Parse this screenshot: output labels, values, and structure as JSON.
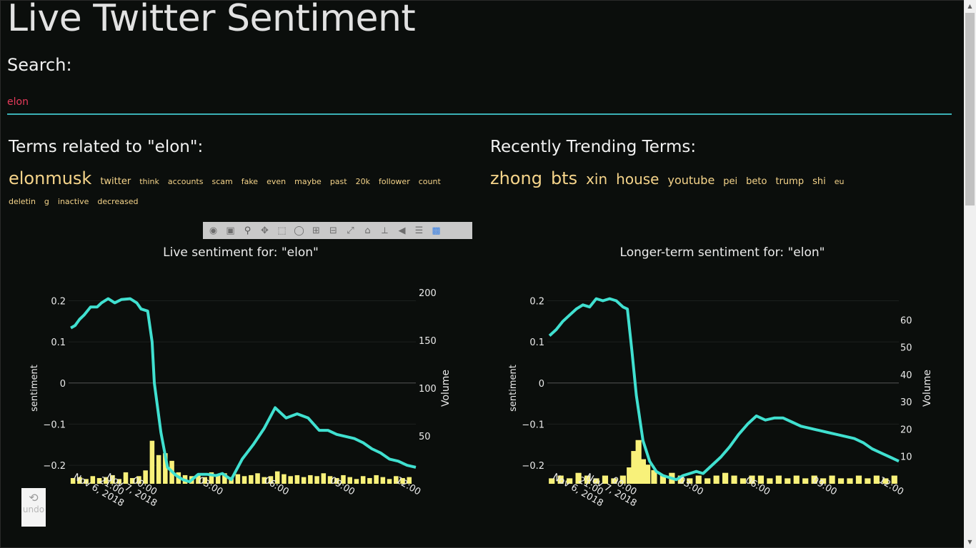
{
  "page": {
    "title": "Live Twitter Sentiment",
    "search_label": "Search:",
    "search_value": "elon",
    "related_heading": "Terms related to \"elon\":",
    "trending_heading": "Recently Trending Terms:",
    "undo_label": "undo"
  },
  "related_terms": [
    {
      "text": "elonmusk",
      "size": "lg"
    },
    {
      "text": "twitter",
      "size": "sm"
    },
    {
      "text": "think",
      "size": "xs"
    },
    {
      "text": "accounts",
      "size": "xs"
    },
    {
      "text": "scam",
      "size": "xs"
    },
    {
      "text": "fake",
      "size": "xs"
    },
    {
      "text": "even",
      "size": "xs"
    },
    {
      "text": "maybe",
      "size": "xs"
    },
    {
      "text": "past",
      "size": "xs"
    },
    {
      "text": "20k",
      "size": "xs"
    },
    {
      "text": "follower",
      "size": "xs"
    },
    {
      "text": "count",
      "size": "xs"
    },
    {
      "text": "deletin",
      "size": "xs"
    },
    {
      "text": "g",
      "size": "xs"
    },
    {
      "text": "inactive",
      "size": "xs"
    },
    {
      "text": "decreased",
      "size": "xs"
    }
  ],
  "trending_terms": [
    {
      "text": "zhong",
      "size": "lg"
    },
    {
      "text": "bts",
      "size": "lg"
    },
    {
      "text": "xin",
      "size": "md"
    },
    {
      "text": "house",
      "size": "md"
    },
    {
      "text": "youtube",
      "size": "sm2"
    },
    {
      "text": "pei",
      "size": "sm"
    },
    {
      "text": "beto",
      "size": "sm"
    },
    {
      "text": "trump",
      "size": "sm"
    },
    {
      "text": "shi",
      "size": "sm"
    },
    {
      "text": "eu",
      "size": "xs"
    }
  ],
  "modebar_icons": [
    "camera-icon",
    "save-icon",
    "zoom-icon",
    "pan-icon",
    "box-select-icon",
    "lasso-icon",
    "zoom-in-icon",
    "zoom-out-icon",
    "autoscale-icon",
    "reset-axes-icon",
    "spike-lines-icon",
    "hover-closest-icon",
    "hover-compare-icon",
    "plotly-logo-icon"
  ],
  "colors": {
    "line": "#40e0d0",
    "bars": "#f8f17a",
    "terms": "#f5d48a",
    "search_text": "#e63a5a",
    "underline": "#3ab0b5"
  },
  "chart_data": [
    {
      "type": "line",
      "title": "Live sentiment for: \"elon\"",
      "ylabel": "sentiment",
      "y2label": "Volume",
      "x_ticks": [
        [
          "21:00",
          "Nov 6, 2018"
        ],
        [
          "00:00",
          "Nov 7, 2018"
        ],
        [
          "03:00",
          ""
        ],
        [
          "06:00",
          ""
        ],
        [
          "09:00",
          ""
        ],
        [
          "12:00",
          ""
        ]
      ],
      "y_ticks": [
        "0.2",
        "0.1",
        "0",
        "−0.1",
        "−0.2"
      ],
      "y2_ticks": [
        "200",
        "150",
        "100",
        "50"
      ],
      "ylim": [
        -0.245,
        0.22
      ],
      "y2lim": [
        0,
        200
      ],
      "xlim": [
        -3.4,
        12.4
      ],
      "line_x": [
        -3.3,
        -3.1,
        -2.9,
        -2.7,
        -2.4,
        -2.1,
        -1.9,
        -1.6,
        -1.3,
        -1.0,
        -0.6,
        -0.3,
        -0.1,
        0.2,
        0.4,
        0.5,
        0.8,
        1.1,
        1.5,
        1.8,
        2.1,
        2.5,
        2.9,
        3.3,
        3.6,
        4.0,
        4.5,
        5.0,
        5.5,
        6.0,
        6.5,
        7.0,
        7.5,
        8.0,
        8.4,
        8.8,
        9.2,
        9.6,
        10.0,
        10.4,
        10.8,
        11.2,
        11.6,
        12.0,
        12.4
      ],
      "line_y": [
        0.134,
        0.14,
        0.155,
        0.165,
        0.185,
        0.185,
        0.195,
        0.205,
        0.195,
        0.203,
        0.205,
        0.195,
        0.18,
        0.175,
        0.1,
        0.0,
        -0.12,
        -0.205,
        -0.225,
        -0.235,
        -0.24,
        -0.222,
        -0.222,
        -0.225,
        -0.22,
        -0.235,
        -0.185,
        -0.15,
        -0.11,
        -0.06,
        -0.085,
        -0.075,
        -0.085,
        -0.115,
        -0.115,
        -0.125,
        -0.13,
        -0.135,
        -0.145,
        -0.16,
        -0.17,
        -0.185,
        -0.19,
        -0.2,
        -0.205
      ],
      "bars_x": [
        -3.2,
        -2.9,
        -2.6,
        -2.3,
        -2.0,
        -1.7,
        -1.4,
        -1.1,
        -0.8,
        -0.5,
        -0.2,
        0.1,
        0.4,
        0.7,
        1.0,
        1.3,
        1.6,
        1.9,
        2.2,
        2.5,
        2.8,
        3.1,
        3.4,
        3.7,
        4.0,
        4.3,
        4.6,
        4.9,
        5.2,
        5.5,
        5.8,
        6.1,
        6.4,
        6.7,
        7.0,
        7.3,
        7.6,
        7.9,
        8.2,
        8.5,
        8.8,
        9.1,
        9.4,
        9.7,
        10.0,
        10.3,
        10.6,
        10.9,
        11.2,
        11.5,
        11.8,
        12.1
      ],
      "bars_v": [
        6,
        7,
        5,
        8,
        6,
        7,
        9,
        5,
        12,
        6,
        8,
        14,
        45,
        30,
        32,
        24,
        12,
        9,
        8,
        10,
        7,
        12,
        9,
        11,
        7,
        10,
        8,
        9,
        11,
        7,
        8,
        13,
        10,
        8,
        9,
        7,
        9,
        8,
        11,
        8,
        6,
        9,
        7,
        5,
        8,
        6,
        9,
        7,
        5,
        8,
        6,
        7
      ]
    },
    {
      "type": "line",
      "title": "Longer-term sentiment for: \"elon\"",
      "ylabel": "sentiment",
      "y2label": "Volume",
      "x_ticks": [
        [
          "21:00",
          "Nov 6, 2018"
        ],
        [
          "00:00",
          "Nov 7, 2018"
        ],
        [
          "03:00",
          ""
        ],
        [
          "06:00",
          ""
        ],
        [
          "09:00",
          ""
        ],
        [
          "12:00",
          ""
        ]
      ],
      "y_ticks": [
        "0.2",
        "0.1",
        "0",
        "−0.1",
        "−0.2"
      ],
      "y2_ticks": [
        "60",
        "50",
        "40",
        "30",
        "20",
        "10"
      ],
      "ylim": [
        -0.245,
        0.22
      ],
      "y2lim": [
        0,
        70
      ],
      "xlim": [
        -3.4,
        12.4
      ],
      "line_x": [
        -3.3,
        -3.0,
        -2.7,
        -2.4,
        -2.1,
        -1.8,
        -1.5,
        -1.2,
        -0.9,
        -0.6,
        -0.3,
        0.0,
        0.2,
        0.4,
        0.6,
        0.9,
        1.2,
        1.5,
        1.8,
        2.1,
        2.4,
        2.7,
        3.0,
        3.3,
        3.6,
        4.0,
        4.4,
        4.8,
        5.2,
        5.6,
        6.0,
        6.4,
        6.8,
        7.2,
        7.6,
        8.0,
        8.4,
        8.8,
        9.2,
        9.6,
        10.0,
        10.4,
        10.8,
        11.2,
        11.6,
        12.0,
        12.4
      ],
      "line_y": [
        0.115,
        0.13,
        0.15,
        0.165,
        0.18,
        0.19,
        0.185,
        0.205,
        0.2,
        0.205,
        0.2,
        0.185,
        0.18,
        0.08,
        -0.03,
        -0.14,
        -0.19,
        -0.215,
        -0.225,
        -0.23,
        -0.235,
        -0.225,
        -0.22,
        -0.215,
        -0.22,
        -0.2,
        -0.18,
        -0.155,
        -0.125,
        -0.1,
        -0.08,
        -0.09,
        -0.085,
        -0.085,
        -0.095,
        -0.105,
        -0.11,
        -0.115,
        -0.12,
        -0.125,
        -0.13,
        -0.135,
        -0.145,
        -0.16,
        -0.17,
        -0.18,
        -0.19
      ],
      "bars_x": [
        -3.2,
        -2.8,
        -2.4,
        -2.0,
        -1.6,
        -1.2,
        -0.8,
        -0.4,
        0.0,
        0.3,
        0.5,
        0.7,
        0.9,
        1.1,
        1.4,
        1.8,
        2.2,
        2.6,
        3.0,
        3.4,
        3.8,
        4.2,
        4.6,
        5.0,
        5.4,
        5.8,
        6.2,
        6.6,
        7.0,
        7.4,
        7.8,
        8.2,
        8.6,
        9.0,
        9.4,
        9.8,
        10.2,
        10.6,
        11.0,
        11.4,
        11.8,
        12.2
      ],
      "bars_v": [
        2,
        3,
        2,
        4,
        3,
        2,
        3,
        2,
        3,
        6,
        12,
        16,
        9,
        7,
        5,
        3,
        4,
        3,
        2,
        3,
        2,
        3,
        4,
        3,
        2,
        3,
        3,
        2,
        3,
        2,
        3,
        2,
        3,
        2,
        3,
        2,
        2,
        3,
        2,
        3,
        2,
        3
      ]
    }
  ]
}
